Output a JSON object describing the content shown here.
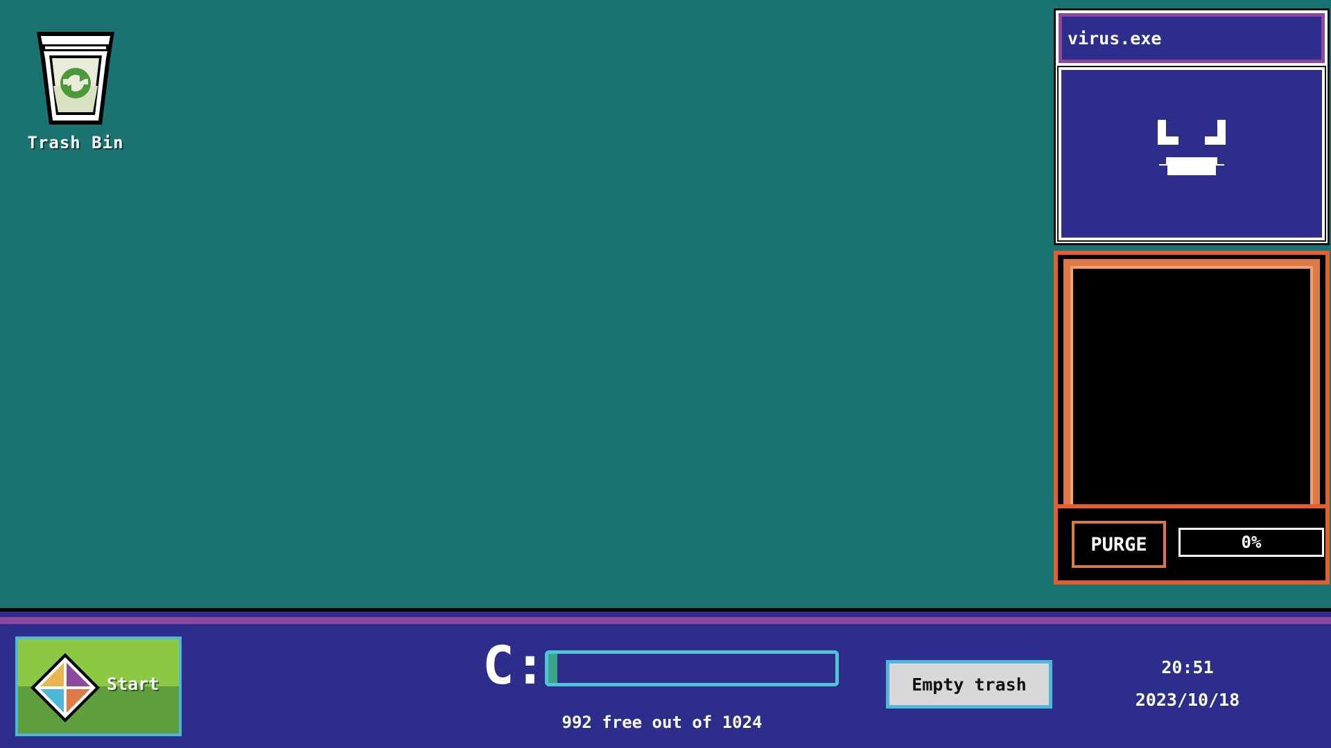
{
  "desktop": {
    "icons": [
      {
        "label": "Trash Bin",
        "icon": "recycle-bin-icon"
      }
    ]
  },
  "virus_window": {
    "title": "virus.exe",
    "face_icon": "grinning-face-icon",
    "colors": {
      "title_bg": "#2d2e8c",
      "title_border": "#8b4a9e",
      "body_bg": "#2d2e8c"
    }
  },
  "purge_panel": {
    "button_label": "PURGE",
    "progress_text": "0%",
    "progress_fraction": 0.0,
    "colors": {
      "frame": "#e2602d",
      "screen": "#000000"
    }
  },
  "taskbar": {
    "start_label": "Start",
    "start_icon": "diamond-logo-icon",
    "drive": {
      "letter": "C:",
      "free": 992,
      "total": 1024,
      "status_text": "992 free out of 1024"
    },
    "empty_trash_label": "Empty trash",
    "clock": {
      "time": "20:51",
      "date": "2023/10/18"
    },
    "colors": {
      "bar_bg": "#2d2e8c",
      "accent_stripe": "#8b4a9e",
      "drive_bar_border": "#4fc4d6"
    }
  },
  "colors": {
    "desktop_bg": "#1b7371"
  }
}
